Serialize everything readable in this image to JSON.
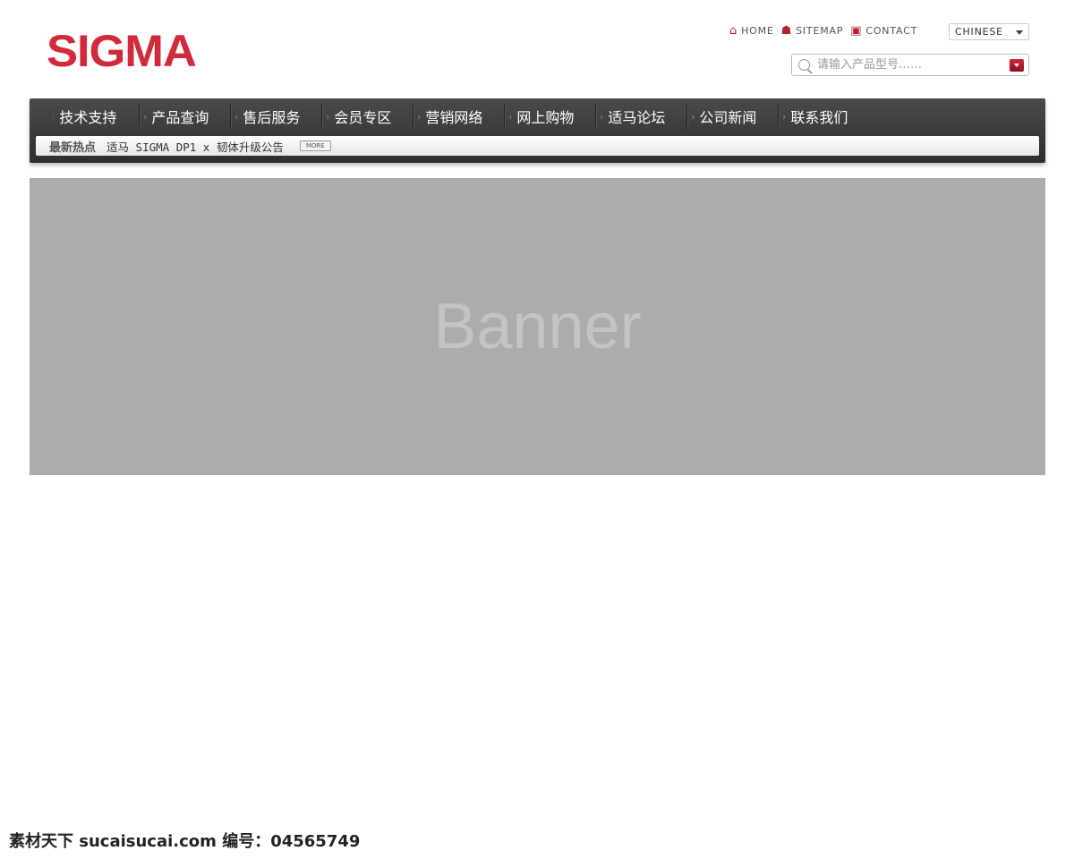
{
  "logo": "SIGMA",
  "toplinks": [
    {
      "label": "HOME",
      "icon": "home-icon"
    },
    {
      "label": "SITEMAP",
      "icon": "sitemap-icon"
    },
    {
      "label": "CONTACT",
      "icon": "contact-icon"
    }
  ],
  "language": {
    "selected": "CHINESE"
  },
  "search": {
    "placeholder": "请输入产品型号……"
  },
  "nav": {
    "items": [
      "技术支持",
      "产品查询",
      "售后服务",
      "会员专区",
      "营销网络",
      "网上购物",
      "适马论坛",
      "公司新闻",
      "联系我们"
    ],
    "active": 0
  },
  "ticker": {
    "label": "最新热点",
    "news": "适马 SIGMA DP1 x 韧体升级公告",
    "more": "MORE"
  },
  "banner": {
    "text": "Banner"
  },
  "watermark": "素材天下 sucaisucai.com  编号：04565749",
  "colors": {
    "brand": "#d22a3a",
    "nav": "#3a3a3a",
    "banner": "#acacac"
  }
}
